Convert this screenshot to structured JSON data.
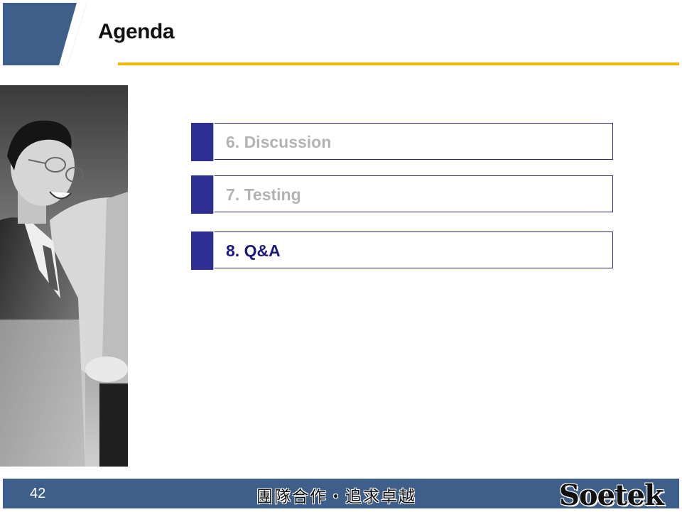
{
  "slide": {
    "title": "Agenda",
    "page_number": "42"
  },
  "agenda": {
    "items": [
      {
        "label": "6. Discussion",
        "state": "inactive"
      },
      {
        "label": "7. Testing",
        "state": "inactive"
      },
      {
        "label": "8. Q&A",
        "state": "active"
      }
    ]
  },
  "footer": {
    "motto": "團隊合作・追求卓越",
    "logo": "Soetek"
  },
  "colors": {
    "header_blue": "#3e5f8a",
    "accent_gold": "#f2b705",
    "marker_navy": "#2e2e93",
    "active_text": "#1a1a80",
    "inactive_text": "#b3b3b3"
  },
  "images": {
    "photo": "business-man-smiling-photo"
  }
}
